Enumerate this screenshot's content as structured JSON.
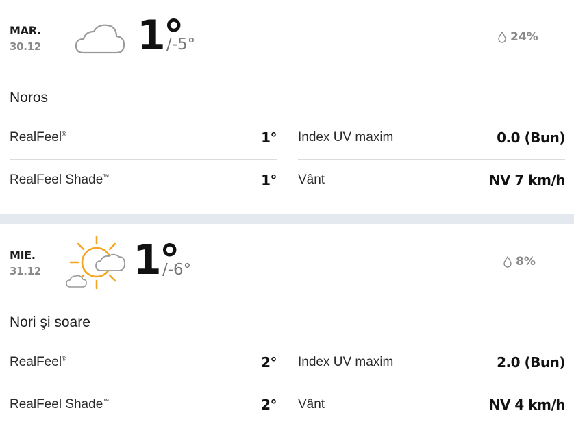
{
  "days": [
    {
      "dow": "MAR.",
      "date": "30.12",
      "icon": "cloud-icon",
      "temp_high": "1°",
      "temp_low": "/-5°",
      "precip": "24%",
      "phrase": "Noros",
      "realfeel_label": "RealFeel",
      "realfeel_mark": "®",
      "realfeel_value": "1°",
      "realfeel_shade_label": "RealFeel Shade",
      "realfeel_shade_mark": "™",
      "realfeel_shade_value": "1°",
      "uv_label": "Index UV maxim",
      "uv_value": "0.0 (Bun)",
      "wind_label": "Vânt",
      "wind_value": "NV 7 km/h"
    },
    {
      "dow": "MIE.",
      "date": "31.12",
      "icon": "sun-and-clouds-icon",
      "temp_high": "1°",
      "temp_low": "/-6°",
      "precip": "8%",
      "phrase": "Nori şi soare",
      "realfeel_label": "RealFeel",
      "realfeel_mark": "®",
      "realfeel_value": "2°",
      "realfeel_shade_label": "RealFeel Shade",
      "realfeel_shade_mark": "™",
      "realfeel_shade_value": "2°",
      "uv_label": "Index UV maxim",
      "uv_value": "2.0 (Bun)",
      "wind_label": "Vânt",
      "wind_value": "NV 4 km/h"
    }
  ],
  "colors": {
    "sun": "#f5a623",
    "cloud_stroke": "#9a9a9a",
    "separator": "#e4e9f0"
  }
}
